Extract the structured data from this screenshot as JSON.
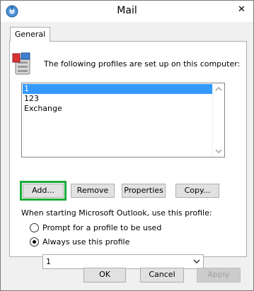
{
  "window": {
    "title": "Mail",
    "close_glyph": "✕"
  },
  "tab": {
    "label": "General"
  },
  "intro_text": "The following profiles are set up on this computer:",
  "profiles": {
    "items": [
      "1",
      "123",
      "Exchange"
    ],
    "selected": "1"
  },
  "buttons": {
    "add": "Add...",
    "remove": "Remove",
    "properties": "Properties",
    "copy": "Copy..."
  },
  "startup": {
    "label": "When starting Microsoft Outlook, use this profile:",
    "prompt_option": "Prompt for a profile to be used",
    "always_option": "Always use this profile",
    "selected_option": "always",
    "profile_value": "1"
  },
  "footer": {
    "ok": "OK",
    "cancel": "Cancel",
    "apply": "Apply"
  },
  "colors": {
    "selection": "#3399ff",
    "highlight_border": "#1aab3a"
  }
}
